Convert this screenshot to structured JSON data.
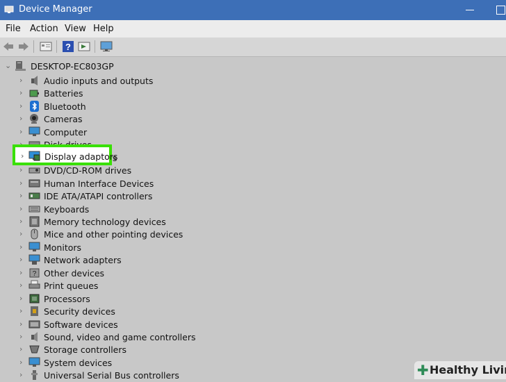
{
  "window": {
    "title": "Device Manager"
  },
  "menu": {
    "items": [
      "File",
      "Action",
      "View",
      "Help"
    ]
  },
  "toolbar": {
    "icons": [
      "back-icon",
      "forward-icon",
      "properties-icon",
      "help-icon",
      "update-driver-icon",
      "monitor-icon"
    ]
  },
  "tree": {
    "root": "DESKTOP-EC803GP",
    "items": [
      "Audio inputs and outputs",
      "Batteries",
      "Bluetooth",
      "Cameras",
      "Computer",
      "Disk drives",
      "Display adaptors",
      "DVD/CD-ROM drives",
      "Human Interface Devices",
      "IDE ATA/ATAPI controllers",
      "Keyboards",
      "Memory technology devices",
      "Mice and other pointing devices",
      "Monitors",
      "Network adapters",
      "Other devices",
      "Print queues",
      "Processors",
      "Security devices",
      "Software devices",
      "Sound, video and game controllers",
      "Storage controllers",
      "System devices",
      "Universal Serial Bus controllers"
    ],
    "highlighted": "Display adaptors"
  },
  "watermark": {
    "text": "Healthy Living"
  },
  "colors": {
    "titlebar": "#3d6fb7",
    "highlight": "#39e000"
  }
}
